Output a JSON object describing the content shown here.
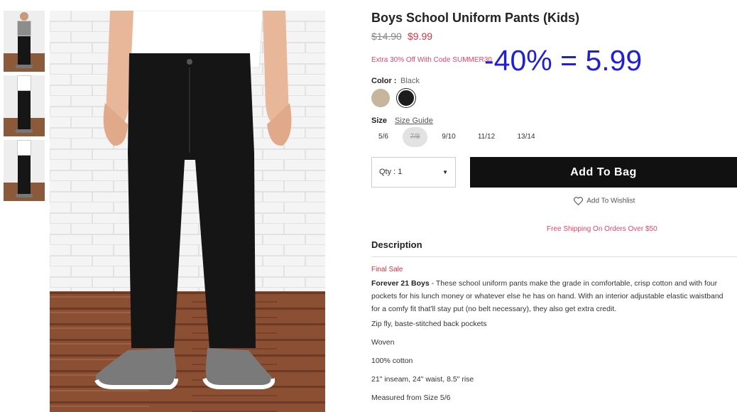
{
  "product": {
    "title": "Boys School Uniform Pants (Kids)",
    "price_original": "$14.90",
    "price_sale": "$9.99",
    "promo": "Extra 30% Off With Code SUMMER30",
    "overlay_note": "-40% = 5.99"
  },
  "color": {
    "label": "Color :",
    "selected": "Black",
    "swatches": [
      "tan",
      "black"
    ]
  },
  "size": {
    "label": "Size",
    "guide": "Size Guide",
    "options": [
      "5/6",
      "7/8",
      "9/10",
      "11/12",
      "13/14"
    ],
    "unavailable": [
      "7/8"
    ]
  },
  "qty": {
    "label": "Qty : 1"
  },
  "actions": {
    "add_to_bag": "Add To Bag",
    "wishlist": "Add To Wishlist"
  },
  "shipping_note": "Free Shipping On Orders Over $50",
  "description": {
    "heading": "Description",
    "final_sale": "Final Sale",
    "brand": "Forever 21 Boys",
    "body": " - These school uniform pants make the grade in comfortable, crisp cotton and with four pockets for his lunch money or whatever else he has on hand. With an interior adjustable elastic waistband for a comfy fit that'll stay put (no belt necessary), they also get extra credit.",
    "details": [
      "Zip fly, baste-stitched back pockets",
      "Woven",
      "100% cotton",
      "21\" inseam, 24\" waist, 8.5\" rise",
      "Measured from Size 5/6"
    ]
  },
  "colors": {
    "sale": "#d9343f",
    "promo": "#e3456b",
    "overlay": "#1f1fd8",
    "button": "#111111"
  }
}
